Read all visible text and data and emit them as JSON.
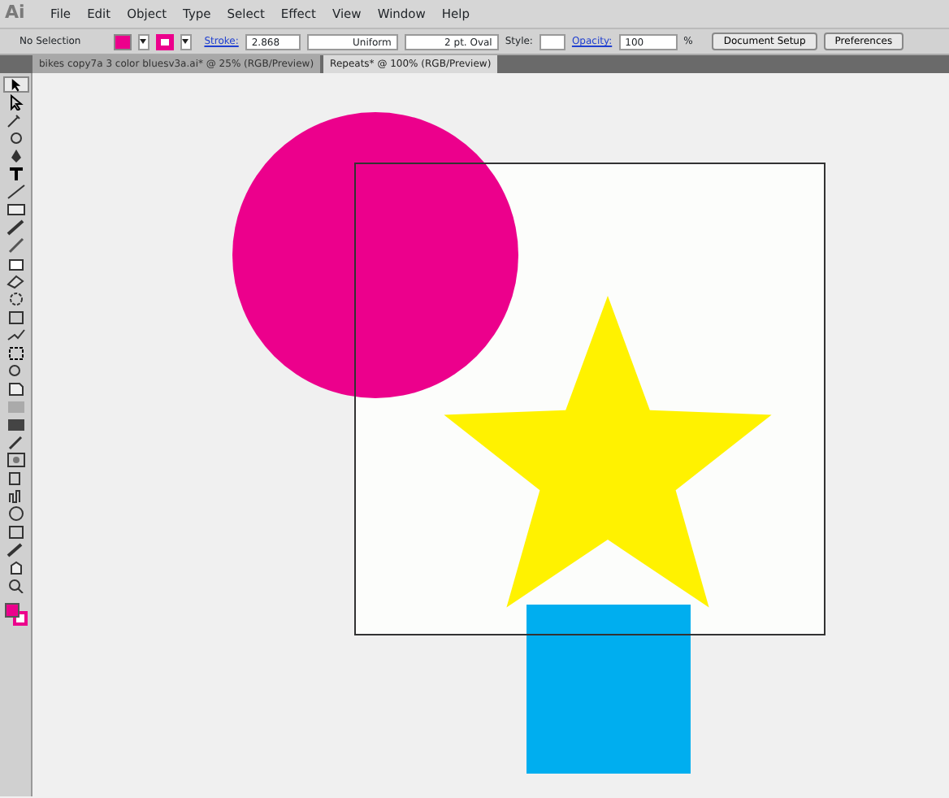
{
  "app_logo": "Ai",
  "menu": [
    "File",
    "Edit",
    "Object",
    "Type",
    "Select",
    "Effect",
    "View",
    "Window",
    "Help"
  ],
  "control_bar": {
    "selection": "No Selection",
    "stroke_label": "Stroke:",
    "stroke_weight": "2.868",
    "profile": "Uniform",
    "brush": "2 pt. Oval",
    "style_label": "Style:",
    "opacity_label": "Opacity:",
    "opacity": "100",
    "percent": "%",
    "buttons": [
      "Document Setup",
      "Preferences"
    ]
  },
  "tabs": [
    {
      "label": "bikes copy7a 3 color bluesv3a.ai* @ 25% (RGB/Preview)",
      "selected": false
    },
    {
      "label": "Repeats* @ 100% (RGB/Preview)",
      "selected": true
    }
  ],
  "shapes": [
    {
      "kind": "circle",
      "color": "#ec008c"
    },
    {
      "kind": "star",
      "color": "#fff200"
    },
    {
      "kind": "square",
      "color": "#00aeef"
    }
  ]
}
